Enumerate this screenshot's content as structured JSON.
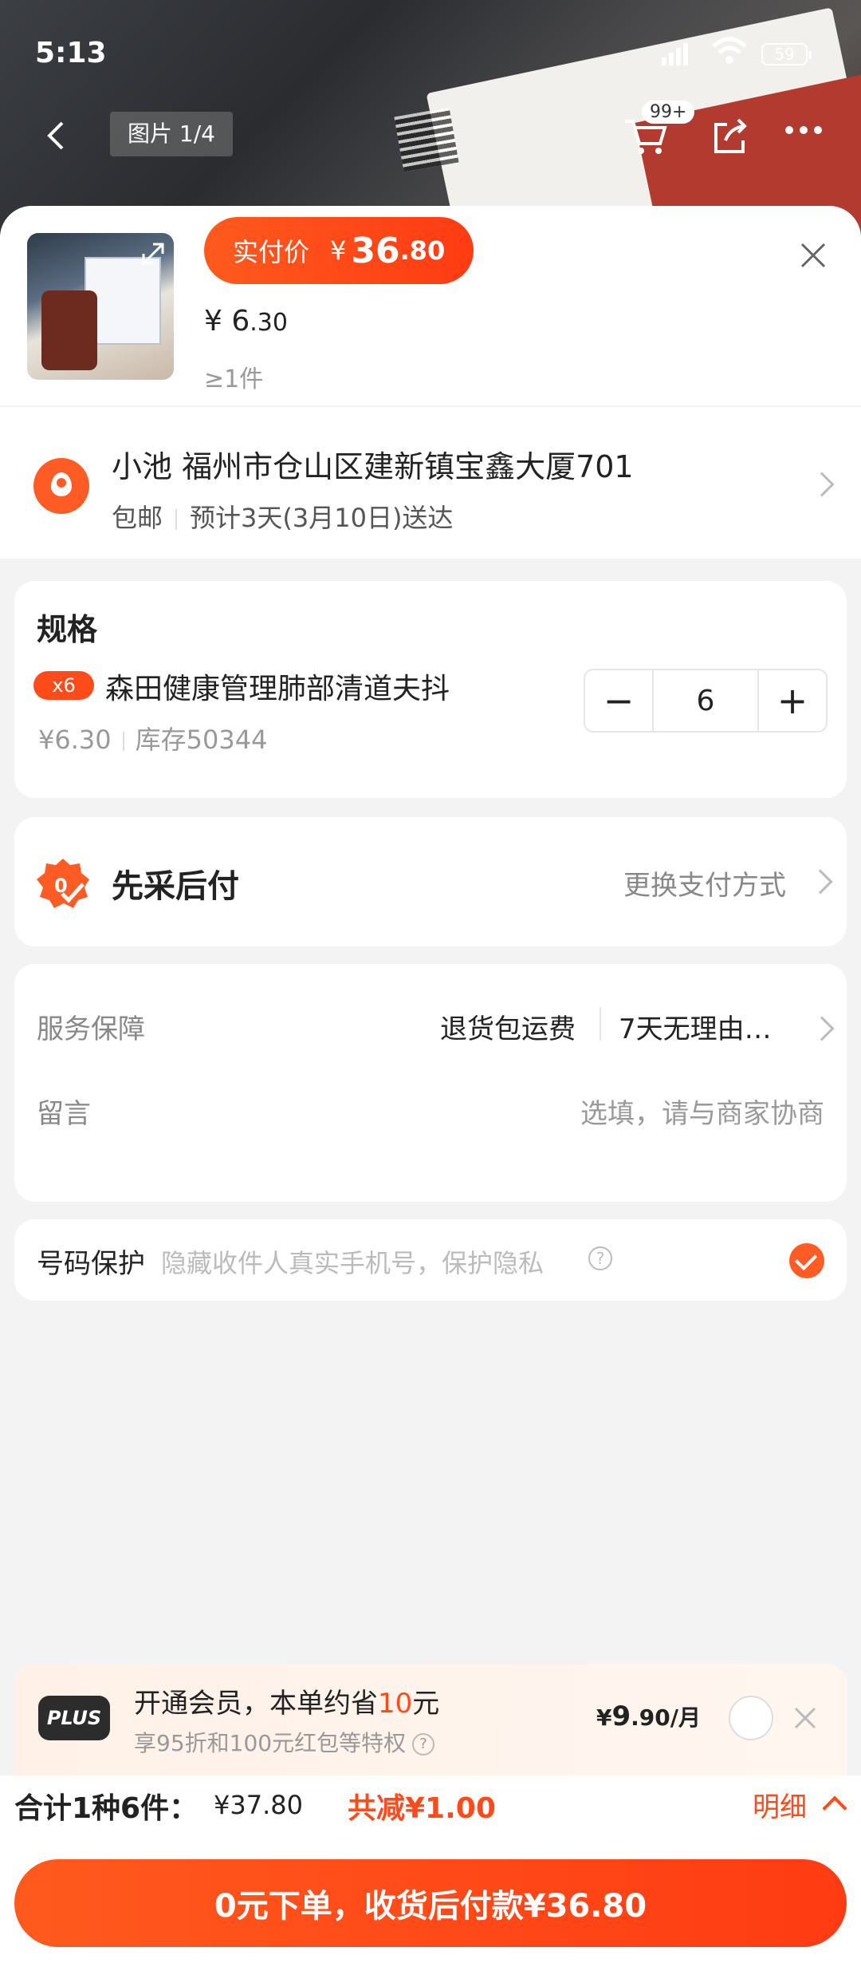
{
  "status_bar": {
    "time": "5:13",
    "battery": "59"
  },
  "viewer": {
    "pager": "图片 1/4",
    "cart_badge": "99+"
  },
  "product": {
    "pay_label": "实付价",
    "pay_yen": "¥",
    "pay_int": "36",
    "pay_dec": ".80",
    "unit_yen": "¥ ",
    "unit_int": "6",
    "unit_dec": ".30",
    "min_qty": "≥1件"
  },
  "address": {
    "line1": "小池 福州市仓山区建新镇宝鑫大厦701",
    "shipping": "包邮",
    "eta": "预计3天(3月10日)送达"
  },
  "spec": {
    "heading": "规格",
    "tag": "x6",
    "name": "森田健康管理肺部清道夫抖",
    "price": "¥6.30",
    "stock": "库存50344",
    "quantity": "6",
    "minus": "−",
    "plus": "+"
  },
  "payment": {
    "title": "先采后付",
    "change": "更换支付方式"
  },
  "service": {
    "label": "服务保障",
    "item1": "退货包运费",
    "item2": "7天无理由…",
    "note_label": "留言",
    "note_placeholder": "选填，请与商家协商"
  },
  "phone_protect": {
    "label": "号码保护",
    "hint": "隐藏收件人真实手机号，保护隐私",
    "help": "?"
  },
  "plus_promo": {
    "badge": "PLUS",
    "line1_prefix": "开通会员，本单约省",
    "line1_amount": "10",
    "line1_suffix": "元",
    "line2": "享95折和100元红包等特权",
    "help": "?",
    "price_yen": "¥",
    "price_int": "9",
    "price_dec": ".90/月"
  },
  "summary": {
    "count": "合计1种6件：",
    "total": "¥37.80",
    "discount": "共减¥1.00",
    "detail": "明细"
  },
  "submit": {
    "label": "0元下单，收货后付款¥36.80"
  },
  "colors": {
    "accent": "#ff4a1a",
    "accent_light": "#ff5b25"
  }
}
